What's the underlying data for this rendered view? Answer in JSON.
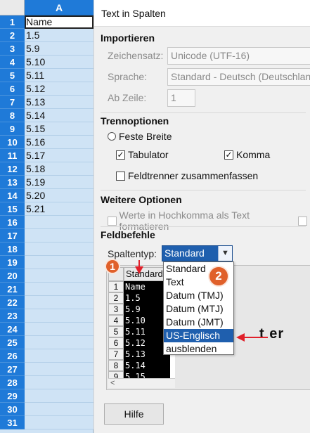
{
  "sheet": {
    "column_header": "A",
    "active_row": 1,
    "rows": [
      {
        "num": "1",
        "value": "Name"
      },
      {
        "num": "2",
        "value": "1.5"
      },
      {
        "num": "3",
        "value": "5.9"
      },
      {
        "num": "4",
        "value": "5.10"
      },
      {
        "num": "5",
        "value": "5.11"
      },
      {
        "num": "6",
        "value": "5.12"
      },
      {
        "num": "7",
        "value": "5.13"
      },
      {
        "num": "8",
        "value": "5.14"
      },
      {
        "num": "9",
        "value": "5.15"
      },
      {
        "num": "10",
        "value": "5.16"
      },
      {
        "num": "11",
        "value": "5.17"
      },
      {
        "num": "12",
        "value": "5.18"
      },
      {
        "num": "13",
        "value": "5.19"
      },
      {
        "num": "14",
        "value": "5.20"
      },
      {
        "num": "15",
        "value": "5.21"
      },
      {
        "num": "16",
        "value": ""
      },
      {
        "num": "17",
        "value": ""
      },
      {
        "num": "18",
        "value": ""
      },
      {
        "num": "19",
        "value": ""
      },
      {
        "num": "20",
        "value": ""
      },
      {
        "num": "21",
        "value": ""
      },
      {
        "num": "22",
        "value": ""
      },
      {
        "num": "23",
        "value": ""
      },
      {
        "num": "24",
        "value": ""
      },
      {
        "num": "25",
        "value": ""
      },
      {
        "num": "26",
        "value": ""
      },
      {
        "num": "27",
        "value": ""
      },
      {
        "num": "28",
        "value": ""
      },
      {
        "num": "29",
        "value": ""
      },
      {
        "num": "30",
        "value": ""
      },
      {
        "num": "31",
        "value": ""
      }
    ]
  },
  "dialog": {
    "title": "Text in Spalten",
    "import": {
      "heading": "Importieren",
      "charset_label": "Zeichensatz:",
      "charset_value": "Unicode (UTF-16)",
      "language_label": "Sprache:",
      "language_value": "Standard - Deutsch (Deutschland)",
      "from_row_label": "Ab Zeile:",
      "from_row_value": "1"
    },
    "separator": {
      "heading": "Trennoptionen",
      "fixed_width": "Feste Breite",
      "tab": "Tabulator",
      "comma": "Komma",
      "merge": "Feldtrenner zusammenfassen"
    },
    "other": {
      "heading": "Weitere Optionen",
      "quoted_as_text": "Werte in Hochkomma als Text formatieren"
    },
    "fields": {
      "heading": "Feldbefehle",
      "column_type_label": "Spaltentyp:",
      "column_type_value": "Standard",
      "options": [
        "Standard",
        "Text",
        "Datum (TMJ)",
        "Datum (MTJ)",
        "Datum (JMT)",
        "US-Englisch",
        "ausblenden"
      ],
      "selected_option": "US-Englisch"
    },
    "preview": {
      "column_header": "Standard",
      "rows": [
        {
          "num": "1",
          "value": "Name"
        },
        {
          "num": "2",
          "value": "1.5"
        },
        {
          "num": "3",
          "value": "5.9"
        },
        {
          "num": "4",
          "value": "5.10"
        },
        {
          "num": "5",
          "value": "5.11"
        },
        {
          "num": "6",
          "value": "5.12"
        },
        {
          "num": "7",
          "value": "5.13"
        },
        {
          "num": "8",
          "value": "5.14"
        },
        {
          "num": "9",
          "value": "5.15"
        }
      ],
      "scroll_left": "<",
      "partial_text": "t er"
    },
    "help_button": "Hilfe"
  },
  "annotations": {
    "badge1": "1",
    "badge2": "2",
    "accent_color": "#e0602a",
    "arrow_color": "#e0202a"
  }
}
